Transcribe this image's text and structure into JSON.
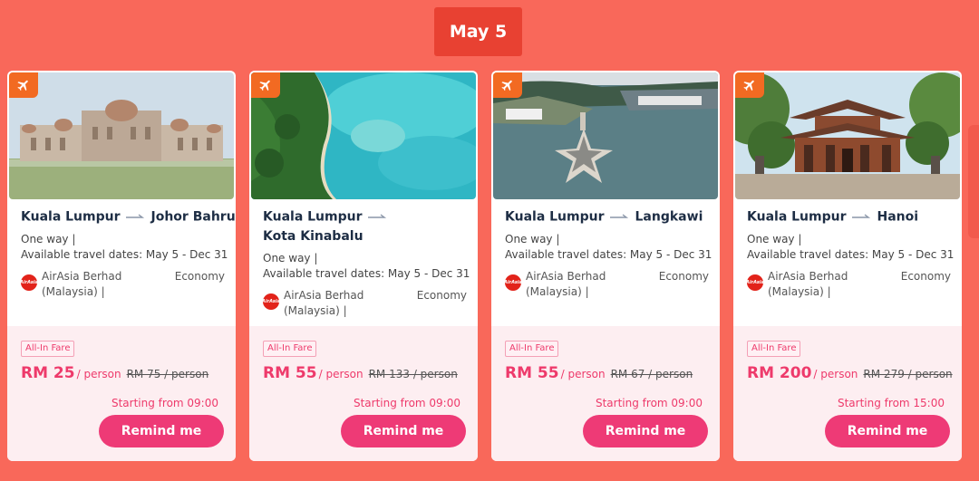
{
  "date_label": "May 5",
  "cards": [
    {
      "origin": "Kuala Lumpur",
      "destination": "Johor Bahru",
      "trip_type": "One way |",
      "travel_dates": "Available travel dates: May 5 - Dec 31",
      "airline_line1": "AirAsia Berhad",
      "airline_line2": "(Malaysia) |",
      "cabin": "Economy",
      "fare_tag": "All-In Fare",
      "price": "RM 25",
      "per_person": "/ person",
      "old_price": "RM 75 / person",
      "start_time": "Starting from 09:00",
      "button": "Remind me",
      "photo": "palace-building-photo"
    },
    {
      "origin": "Kuala Lumpur",
      "destination": "Kota Kinabalu",
      "trip_type": "One way |",
      "travel_dates": "Available travel dates: May 5 - Dec 31",
      "airline_line1": "AirAsia Berhad",
      "airline_line2": "(Malaysia) |",
      "cabin": "Economy",
      "fare_tag": "All-In Fare",
      "price": "RM 55",
      "per_person": "/ person",
      "old_price": "RM 133 / person",
      "start_time": "Starting from 09:00",
      "button": "Remind me",
      "photo": "tropical-beach-aerial-photo"
    },
    {
      "origin": "Kuala Lumpur",
      "destination": "Langkawi",
      "trip_type": "One way |",
      "travel_dates": "Available travel dates: May 5 - Dec 31",
      "airline_line1": "AirAsia Berhad",
      "airline_line2": "(Malaysia) |",
      "cabin": "Economy",
      "fare_tag": "All-In Fare",
      "price": "RM 55",
      "per_person": "/ person",
      "old_price": "RM 67 / person",
      "start_time": "Starting from 09:00",
      "button": "Remind me",
      "photo": "star-jetty-harbor-photo"
    },
    {
      "origin": "Kuala Lumpur",
      "destination": "Hanoi",
      "trip_type": "One way |",
      "travel_dates": "Available travel dates: May 5 - Dec 31",
      "airline_line1": "AirAsia Berhad",
      "airline_line2": "(Malaysia) |",
      "cabin": "Economy",
      "fare_tag": "All-In Fare",
      "price": "RM 200",
      "per_person": "/ person",
      "old_price": "RM 279 / person",
      "start_time": "Starting from 15:00",
      "button": "Remind me",
      "photo": "pagoda-temple-photo"
    }
  ],
  "colors": {
    "background": "#f9685a",
    "date_badge": "#e84132",
    "accent_pink": "#ee3a6b",
    "plane_badge": "#f26a22",
    "fare_panel": "#fdeef1"
  }
}
